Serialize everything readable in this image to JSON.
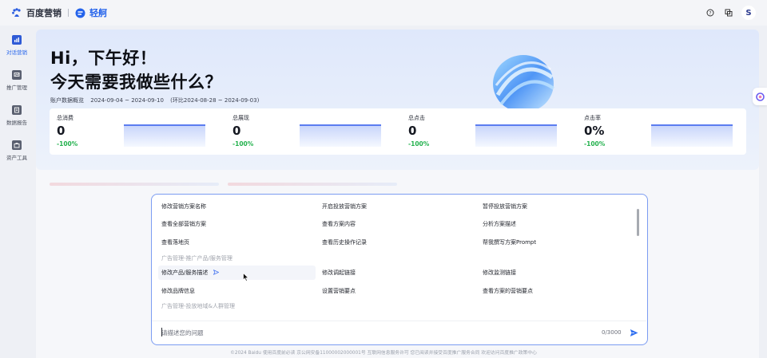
{
  "topbar": {
    "brand": "百度营销",
    "product": "轻舸",
    "avatar": "S",
    "icons": [
      "help-icon",
      "layers-icon"
    ]
  },
  "sidebar": {
    "items": [
      {
        "label": "对话营销",
        "icon": "chat-chart-icon",
        "active": true
      },
      {
        "label": "推广管理",
        "icon": "monitor-icon",
        "active": false
      },
      {
        "label": "数据报告",
        "icon": "report-icon",
        "active": false
      },
      {
        "label": "资产工具",
        "icon": "toolbox-icon",
        "active": false
      }
    ]
  },
  "hero": {
    "greeting": "Hi，下午好！",
    "question": "今天需要我做些什么？",
    "range_label": "账户数据概览",
    "range_dates": "2024-09-04 ~ 2024-09-10",
    "range_compare": "(环比2024-08-28 ~ 2024-09-03)"
  },
  "stats": [
    {
      "title": "总消费",
      "value": "0",
      "change": "-100%"
    },
    {
      "title": "总展现",
      "value": "0",
      "change": "-100%"
    },
    {
      "title": "总点击",
      "value": "0",
      "change": "-100%"
    },
    {
      "title": "点击率",
      "value": "0%",
      "change": "-100%"
    }
  ],
  "commands": {
    "row1": [
      "修改营销方案名称",
      "开启投放营销方案",
      "暂停投放营销方案"
    ],
    "row2": [
      "查看全部营销方案",
      "查看方案内容",
      "分析方案描述"
    ],
    "row3": [
      "查看落地页",
      "查看历史操作记录",
      "帮我撰写方案Prompt"
    ],
    "group1": "广告管理-推广产品/服务管理",
    "row4": [
      "修改产品/服务描述",
      "修改调起链接",
      "修改监测链接"
    ],
    "row5": [
      "修改品牌信息",
      "设置营销要点",
      "查看方案的营销要点"
    ],
    "group2": "广告管理-投放地域&人群管理"
  },
  "input": {
    "placeholder": "请描述您的问题",
    "counter": "0/3000"
  },
  "footer": {
    "text": "©2024 Baidu 使用百度前必读 京公网安备11000002000001号 互联网信息服务许可 您已阅读并接受百度推广服务合同 欢迎访问百度推广政策中心"
  },
  "colors": {
    "accent": "#2463eb",
    "positive": "#23b14d",
    "panel_border": "#7b9cf2"
  }
}
